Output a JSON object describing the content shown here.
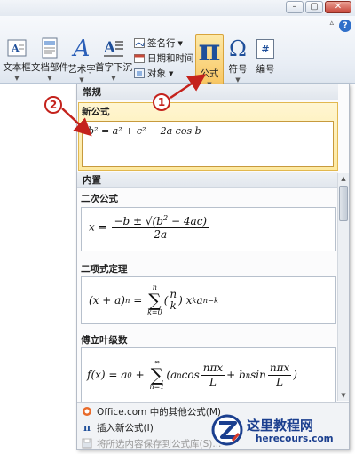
{
  "window": {
    "min_glyph": "–",
    "max_glyph": "▢",
    "close_glyph": "✕"
  },
  "ribbon": {
    "help_glyph": "?",
    "collapse_glyph": "▵",
    "buttons": {
      "textbox": "文本框",
      "quick_parts": "文档部件",
      "wordart": "艺术字",
      "dropcap": "首字下沉",
      "signature": "签名行",
      "datetime": "日期和时间",
      "object": "对象",
      "equation": "公式",
      "symbol": "符号",
      "number": "编号"
    },
    "glyphs": {
      "equation": "π",
      "symbol": "Ω",
      "number": "#",
      "wordart": "A",
      "dropdown": "▼"
    }
  },
  "gallery": {
    "section_normal": "常规",
    "new_item_label": "新公式",
    "new_item_equation": "b² = a² + c² − 2a cos b",
    "section_builtin": "内置",
    "items": [
      {
        "label": "二次公式"
      },
      {
        "label": "二项式定理"
      },
      {
        "label": "傅立叶级数"
      }
    ],
    "bottom": [
      {
        "label": "Office.com 中的其他公式(M)",
        "icon": "office-icon",
        "enabled": true
      },
      {
        "label": "插入新公式(I)",
        "icon": "pi-icon",
        "enabled": true
      },
      {
        "label": "将所选内容保存到公式库(S)...",
        "icon": "save-icon",
        "enabled": false
      }
    ]
  },
  "annotations": {
    "badge_1": "1",
    "badge_2": "2"
  },
  "watermark": {
    "title": "这里教程网",
    "url": "herecours.com"
  },
  "colors": {
    "accent_highlight": "#fde9a0",
    "annotation_red": "#c4221c",
    "brand_blue": "#1f4f9a"
  }
}
